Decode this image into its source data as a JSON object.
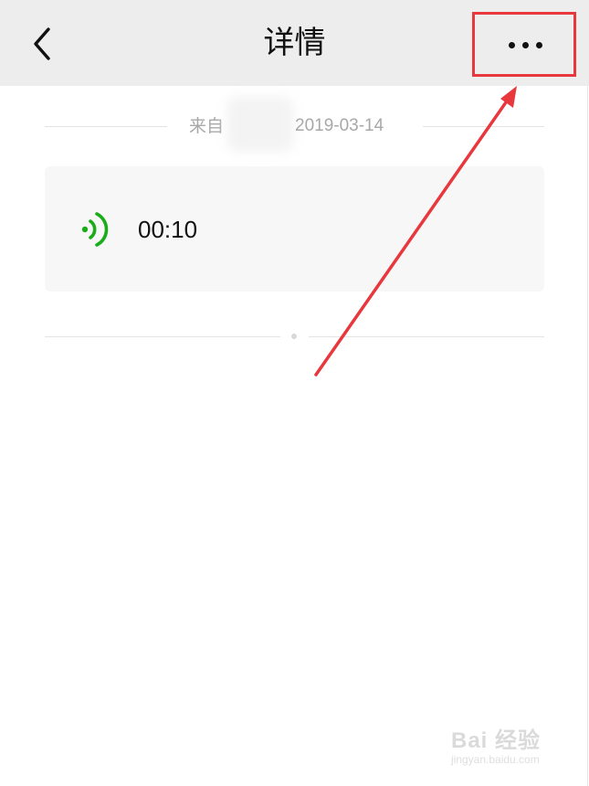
{
  "navbar": {
    "title": "详情",
    "back_icon": "chevron-left-icon",
    "more_icon": "more-horizontal-icon"
  },
  "source": {
    "prefix": "来自",
    "date": "2019-03-14"
  },
  "voice": {
    "duration": "00:10",
    "icon": "voice-wave-icon",
    "icon_color": "#1aad19"
  },
  "annotation": {
    "color": "#e8383d"
  },
  "watermark": {
    "logo": "Bai 经验",
    "url": "jingyan.baidu.com"
  }
}
